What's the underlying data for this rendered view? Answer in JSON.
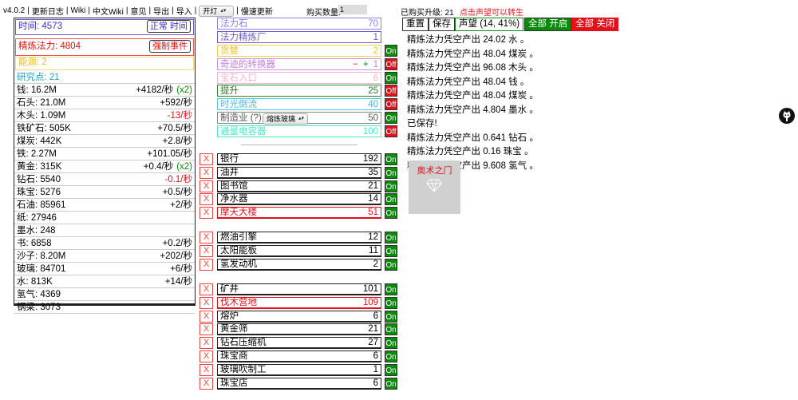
{
  "topbar": {
    "version": "v4.0.2",
    "links": [
      "更新日志",
      "Wiki",
      "中文Wiki",
      "意见",
      "导出",
      "导入"
    ],
    "light_select": "开灯",
    "slow_update": "慢速更新",
    "buy_qty_label": "购买数量:",
    "buy_qty_value": "1",
    "bought_upgrades": "已购买升级: 21",
    "hint": "点击声望可以转生"
  },
  "left": {
    "time_label": "时间: 4573",
    "time_button": "正常 时间",
    "mana_label": "精炼法力: 4804",
    "force_event_button": "强制事件",
    "energy": "能源: 2",
    "research": "研究点: 21",
    "resources": [
      {
        "name": "钱: 16.2M",
        "rate": "+4182/秒",
        "mult": "(x2)"
      },
      {
        "name": "石头: 21.0M",
        "rate": "+592/秒",
        "mult": ""
      },
      {
        "name": "木头: 1.09M",
        "rate": "-13/秒",
        "mult": ""
      },
      {
        "name": "铁矿石: 505K",
        "rate": "+70.5/秒",
        "mult": ""
      },
      {
        "name": "煤炭: 442K",
        "rate": "+2.8/秒",
        "mult": ""
      },
      {
        "name": "铁: 2.27M",
        "rate": "+101.05/秒",
        "mult": ""
      },
      {
        "name": "黄金: 315K",
        "rate": "+0.4/秒",
        "mult": "(x2)"
      },
      {
        "name": "钻石: 5540",
        "rate": "-0.1/秒",
        "mult": ""
      },
      {
        "name": "珠宝: 5276",
        "rate": "+0.5/秒",
        "mult": ""
      },
      {
        "name": "石油: 85961",
        "rate": "+2/秒",
        "mult": ""
      },
      {
        "name": "纸: 27946",
        "rate": "",
        "mult": ""
      },
      {
        "name": "墨水: 248",
        "rate": "",
        "mult": ""
      },
      {
        "name": "书: 6858",
        "rate": "+0.2/秒",
        "mult": ""
      },
      {
        "name": "沙子: 8.20M",
        "rate": "+202/秒",
        "mult": ""
      },
      {
        "name": "玻璃: 84701",
        "rate": "+6/秒",
        "mult": ""
      },
      {
        "name": "水: 813K",
        "rate": "+14/秒",
        "mult": ""
      },
      {
        "name": "氢气: 4369",
        "rate": "",
        "mult": ""
      },
      {
        "name": "钢梁: 3073",
        "rate": "",
        "mult": ""
      }
    ]
  },
  "magic": [
    {
      "name": "法力石",
      "value": "70"
    },
    {
      "name": "法力精炼厂",
      "value": "1"
    },
    {
      "name": "贪婪",
      "value": "2",
      "toggle": "On"
    },
    {
      "name": "奇迹的转换器",
      "minus": "−",
      "plus": "+",
      "value": "1",
      "toggle": "Off"
    },
    {
      "name": "宝石入口",
      "value": "6",
      "toggle": "On"
    },
    {
      "name": "提升",
      "value": "25",
      "toggle": "Off"
    },
    {
      "name": "时光倒流",
      "value": "40",
      "toggle": "Off"
    },
    {
      "name": "制造业 (?)",
      "select": "熔炼玻璃",
      "value": "50",
      "toggle": "On"
    },
    {
      "name": "通量电容器",
      "value": "100",
      "toggle": "Off"
    }
  ],
  "group1": [
    {
      "name": "银行",
      "value": "192",
      "toggle": "On"
    },
    {
      "name": "油井",
      "value": "35",
      "toggle": "On"
    },
    {
      "name": "图书馆",
      "value": "21",
      "toggle": "On"
    },
    {
      "name": "净水器",
      "value": "14",
      "toggle": "On"
    },
    {
      "name": "摩天大楼",
      "value": "51",
      "toggle": "On"
    }
  ],
  "group2": [
    {
      "name": "燃油引擎",
      "value": "12",
      "toggle": "On"
    },
    {
      "name": "太阳能板",
      "value": "11",
      "toggle": "On"
    },
    {
      "name": "氢发动机",
      "value": "2",
      "toggle": "On"
    }
  ],
  "group3": [
    {
      "name": "矿井",
      "value": "101",
      "toggle": "On"
    },
    {
      "name": "伐木营地",
      "value": "109",
      "toggle": "On"
    },
    {
      "name": "熔炉",
      "value": "6",
      "toggle": "On"
    },
    {
      "name": "黄金筛",
      "value": "21",
      "toggle": "On"
    },
    {
      "name": "钻石压缩机",
      "value": "27",
      "toggle": "On"
    },
    {
      "name": "珠宝商",
      "value": "6",
      "toggle": "On"
    },
    {
      "name": "玻璃吹制工",
      "value": "1",
      "toggle": "On"
    },
    {
      "name": "珠宝店",
      "value": "6",
      "toggle": "On"
    }
  ],
  "x_label": "X",
  "right": {
    "reset": "重置",
    "save": "保存",
    "prestige": "声望 (14, 41%)",
    "all_on": "全部 开启",
    "all_off": "全部 关闭",
    "log": [
      "精炼法力凭空产出 24.02 水 。",
      "精炼法力凭空产出 48.04 煤炭 。",
      "精炼法力凭空产出 96.08 木头 。",
      "精炼法力凭空产出 48.04 钱 。",
      "精炼法力凭空产出 48.04 煤炭 。",
      "精炼法力凭空产出 4.804 墨水 。",
      "已保存!",
      "精炼法力凭空产出 0.641 钻石 。",
      "精炼法力凭空产出 0.16 珠宝 。",
      "精炼法力凭空产出 9.608 氢气 。"
    ],
    "portal_label": "奥术之门"
  }
}
